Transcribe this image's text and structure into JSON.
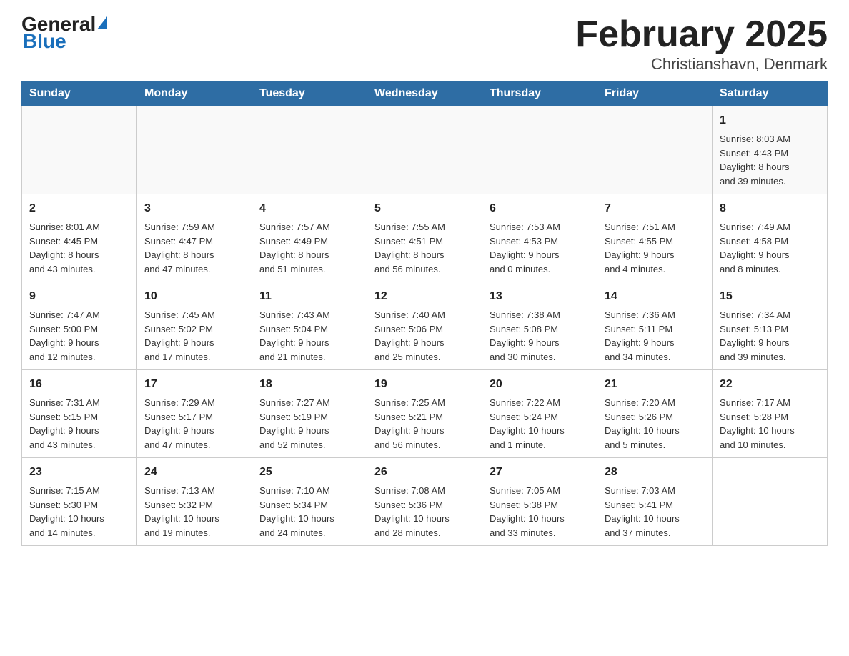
{
  "logo": {
    "general": "General",
    "blue": "Blue"
  },
  "title": "February 2025",
  "subtitle": "Christianshavn, Denmark",
  "weekdays": [
    "Sunday",
    "Monday",
    "Tuesday",
    "Wednesday",
    "Thursday",
    "Friday",
    "Saturday"
  ],
  "weeks": [
    [
      {
        "day": "",
        "info": ""
      },
      {
        "day": "",
        "info": ""
      },
      {
        "day": "",
        "info": ""
      },
      {
        "day": "",
        "info": ""
      },
      {
        "day": "",
        "info": ""
      },
      {
        "day": "",
        "info": ""
      },
      {
        "day": "1",
        "info": "Sunrise: 8:03 AM\nSunset: 4:43 PM\nDaylight: 8 hours\nand 39 minutes."
      }
    ],
    [
      {
        "day": "2",
        "info": "Sunrise: 8:01 AM\nSunset: 4:45 PM\nDaylight: 8 hours\nand 43 minutes."
      },
      {
        "day": "3",
        "info": "Sunrise: 7:59 AM\nSunset: 4:47 PM\nDaylight: 8 hours\nand 47 minutes."
      },
      {
        "day": "4",
        "info": "Sunrise: 7:57 AM\nSunset: 4:49 PM\nDaylight: 8 hours\nand 51 minutes."
      },
      {
        "day": "5",
        "info": "Sunrise: 7:55 AM\nSunset: 4:51 PM\nDaylight: 8 hours\nand 56 minutes."
      },
      {
        "day": "6",
        "info": "Sunrise: 7:53 AM\nSunset: 4:53 PM\nDaylight: 9 hours\nand 0 minutes."
      },
      {
        "day": "7",
        "info": "Sunrise: 7:51 AM\nSunset: 4:55 PM\nDaylight: 9 hours\nand 4 minutes."
      },
      {
        "day": "8",
        "info": "Sunrise: 7:49 AM\nSunset: 4:58 PM\nDaylight: 9 hours\nand 8 minutes."
      }
    ],
    [
      {
        "day": "9",
        "info": "Sunrise: 7:47 AM\nSunset: 5:00 PM\nDaylight: 9 hours\nand 12 minutes."
      },
      {
        "day": "10",
        "info": "Sunrise: 7:45 AM\nSunset: 5:02 PM\nDaylight: 9 hours\nand 17 minutes."
      },
      {
        "day": "11",
        "info": "Sunrise: 7:43 AM\nSunset: 5:04 PM\nDaylight: 9 hours\nand 21 minutes."
      },
      {
        "day": "12",
        "info": "Sunrise: 7:40 AM\nSunset: 5:06 PM\nDaylight: 9 hours\nand 25 minutes."
      },
      {
        "day": "13",
        "info": "Sunrise: 7:38 AM\nSunset: 5:08 PM\nDaylight: 9 hours\nand 30 minutes."
      },
      {
        "day": "14",
        "info": "Sunrise: 7:36 AM\nSunset: 5:11 PM\nDaylight: 9 hours\nand 34 minutes."
      },
      {
        "day": "15",
        "info": "Sunrise: 7:34 AM\nSunset: 5:13 PM\nDaylight: 9 hours\nand 39 minutes."
      }
    ],
    [
      {
        "day": "16",
        "info": "Sunrise: 7:31 AM\nSunset: 5:15 PM\nDaylight: 9 hours\nand 43 minutes."
      },
      {
        "day": "17",
        "info": "Sunrise: 7:29 AM\nSunset: 5:17 PM\nDaylight: 9 hours\nand 47 minutes."
      },
      {
        "day": "18",
        "info": "Sunrise: 7:27 AM\nSunset: 5:19 PM\nDaylight: 9 hours\nand 52 minutes."
      },
      {
        "day": "19",
        "info": "Sunrise: 7:25 AM\nSunset: 5:21 PM\nDaylight: 9 hours\nand 56 minutes."
      },
      {
        "day": "20",
        "info": "Sunrise: 7:22 AM\nSunset: 5:24 PM\nDaylight: 10 hours\nand 1 minute."
      },
      {
        "day": "21",
        "info": "Sunrise: 7:20 AM\nSunset: 5:26 PM\nDaylight: 10 hours\nand 5 minutes."
      },
      {
        "day": "22",
        "info": "Sunrise: 7:17 AM\nSunset: 5:28 PM\nDaylight: 10 hours\nand 10 minutes."
      }
    ],
    [
      {
        "day": "23",
        "info": "Sunrise: 7:15 AM\nSunset: 5:30 PM\nDaylight: 10 hours\nand 14 minutes."
      },
      {
        "day": "24",
        "info": "Sunrise: 7:13 AM\nSunset: 5:32 PM\nDaylight: 10 hours\nand 19 minutes."
      },
      {
        "day": "25",
        "info": "Sunrise: 7:10 AM\nSunset: 5:34 PM\nDaylight: 10 hours\nand 24 minutes."
      },
      {
        "day": "26",
        "info": "Sunrise: 7:08 AM\nSunset: 5:36 PM\nDaylight: 10 hours\nand 28 minutes."
      },
      {
        "day": "27",
        "info": "Sunrise: 7:05 AM\nSunset: 5:38 PM\nDaylight: 10 hours\nand 33 minutes."
      },
      {
        "day": "28",
        "info": "Sunrise: 7:03 AM\nSunset: 5:41 PM\nDaylight: 10 hours\nand 37 minutes."
      },
      {
        "day": "",
        "info": ""
      }
    ]
  ]
}
